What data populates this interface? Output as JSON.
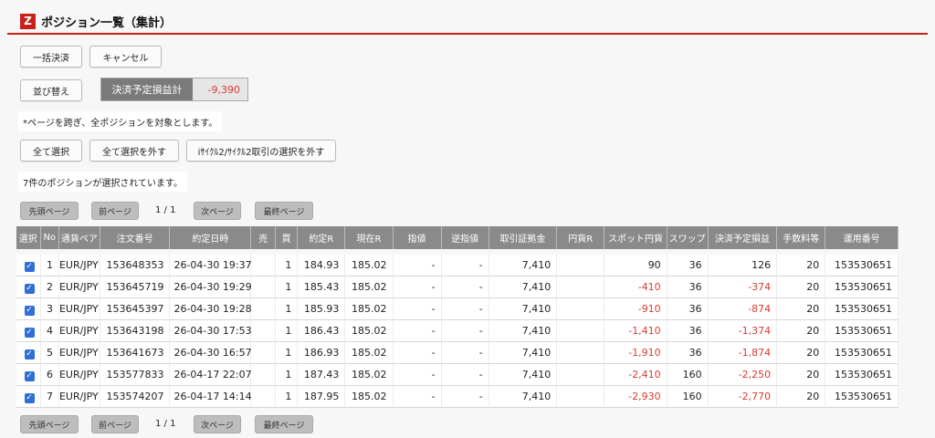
{
  "header": {
    "logo": "Z",
    "title": "ポジション一覧（集計）"
  },
  "buttons": {
    "bulk_settle": "一括決済",
    "cancel": "キャンセル",
    "sort": "並び替え",
    "select_all": "全て選択",
    "deselect_all": "全て選択を外す",
    "deselect_cycle": "iｻｲｸﾙ2/ｻｲｸﾙ2取引の選択を外す"
  },
  "pl_summary": {
    "label": "決済予定損益計",
    "value": "-9,390"
  },
  "notes": {
    "all_pages": "*ページを跨ぎ、全ポジションを対象とします。",
    "selected": "7件のポジションが選択されています。"
  },
  "pagination": {
    "first": "先頭ページ",
    "prev": "前ページ",
    "page": "1 / 1",
    "next": "次ページ",
    "last": "最終ページ"
  },
  "table": {
    "headers": [
      "選択",
      "No",
      "通貨ペア",
      "注文番号",
      "約定日時",
      "売",
      "買",
      "約定R",
      "現在R",
      "指値",
      "逆指値",
      "取引証拠金",
      "円貨R",
      "スポット円貨",
      "スワップ",
      "決済予定損益",
      "手数料等",
      "運用番号"
    ],
    "rows": [
      [
        "✓",
        "1",
        "EUR/JPY",
        "153648353",
        "26-04-30 19:37",
        "",
        "1",
        "184.93",
        "185.02",
        "-",
        "-",
        "7,410",
        "",
        "90",
        "36",
        "126",
        "20",
        "153530651"
      ],
      [
        "✓",
        "2",
        "EUR/JPY",
        "153645719",
        "26-04-30 19:29",
        "",
        "1",
        "185.43",
        "185.02",
        "-",
        "-",
        "7,410",
        "",
        "-410",
        "36",
        "-374",
        "20",
        "153530651"
      ],
      [
        "✓",
        "3",
        "EUR/JPY",
        "153645397",
        "26-04-30 19:28",
        "",
        "1",
        "185.93",
        "185.02",
        "-",
        "-",
        "7,410",
        "",
        "-910",
        "36",
        "-874",
        "20",
        "153530651"
      ],
      [
        "✓",
        "4",
        "EUR/JPY",
        "153643198",
        "26-04-30 17:53",
        "",
        "1",
        "186.43",
        "185.02",
        "-",
        "-",
        "7,410",
        "",
        "-1,410",
        "36",
        "-1,374",
        "20",
        "153530651"
      ],
      [
        "✓",
        "5",
        "EUR/JPY",
        "153641673",
        "26-04-30 16:57",
        "",
        "1",
        "186.93",
        "185.02",
        "-",
        "-",
        "7,410",
        "",
        "-1,910",
        "36",
        "-1,874",
        "20",
        "153530651"
      ],
      [
        "✓",
        "6",
        "EUR/JPY",
        "153577833",
        "26-04-17 22:07",
        "",
        "1",
        "187.43",
        "185.02",
        "-",
        "-",
        "7,410",
        "",
        "-2,410",
        "160",
        "-2,250",
        "20",
        "153530651"
      ],
      [
        "✓",
        "7",
        "EUR/JPY",
        "153574207",
        "26-04-17 14:14",
        "",
        "1",
        "187.95",
        "185.02",
        "-",
        "-",
        "7,410",
        "",
        "-2,930",
        "160",
        "-2,770",
        "20",
        "153530651"
      ]
    ]
  },
  "colors": {
    "accent": "#c8201a",
    "negative": "#d83b30",
    "checkbox": "#2f6fd6"
  }
}
